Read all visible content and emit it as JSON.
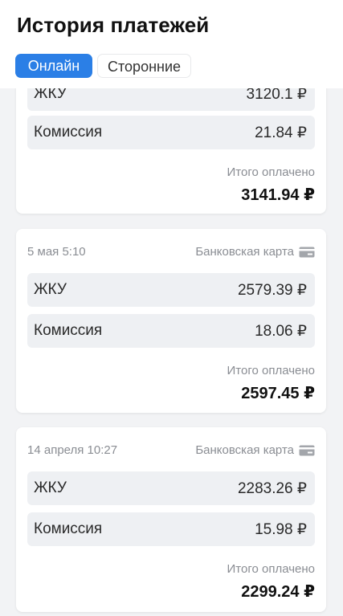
{
  "header": {
    "title": "История платежей",
    "tabs": [
      {
        "label": "Онлайн",
        "active": true
      },
      {
        "label": "Сторонние",
        "active": false
      }
    ]
  },
  "colors": {
    "accent": "#2b7fe6",
    "background": "#f2f3f5",
    "card": "#ffffff",
    "line_item_bg": "#eef0f3",
    "muted_text": "#8a8d93"
  },
  "payments": [
    {
      "date": "",
      "method": "",
      "method_icon": "bank-card-icon",
      "items": [
        {
          "label": "ЖКУ",
          "amount": "3120.1 ₽"
        },
        {
          "label": "Комиссия",
          "amount": "21.84 ₽"
        }
      ],
      "total_label": "Итого оплачено",
      "total": "3141.94 ₽"
    },
    {
      "date": "5 мая 5:10",
      "method": "Банковская карта",
      "method_icon": "bank-card-icon",
      "items": [
        {
          "label": "ЖКУ",
          "amount": "2579.39 ₽"
        },
        {
          "label": "Комиссия",
          "amount": "18.06 ₽"
        }
      ],
      "total_label": "Итого оплачено",
      "total": "2597.45 ₽"
    },
    {
      "date": "14 апреля 10:27",
      "method": "Банковская карта",
      "method_icon": "bank-card-icon",
      "items": [
        {
          "label": "ЖКУ",
          "amount": "2283.26 ₽"
        },
        {
          "label": "Комиссия",
          "amount": "15.98 ₽"
        }
      ],
      "total_label": "Итого оплачено",
      "total": "2299.24 ₽"
    }
  ]
}
